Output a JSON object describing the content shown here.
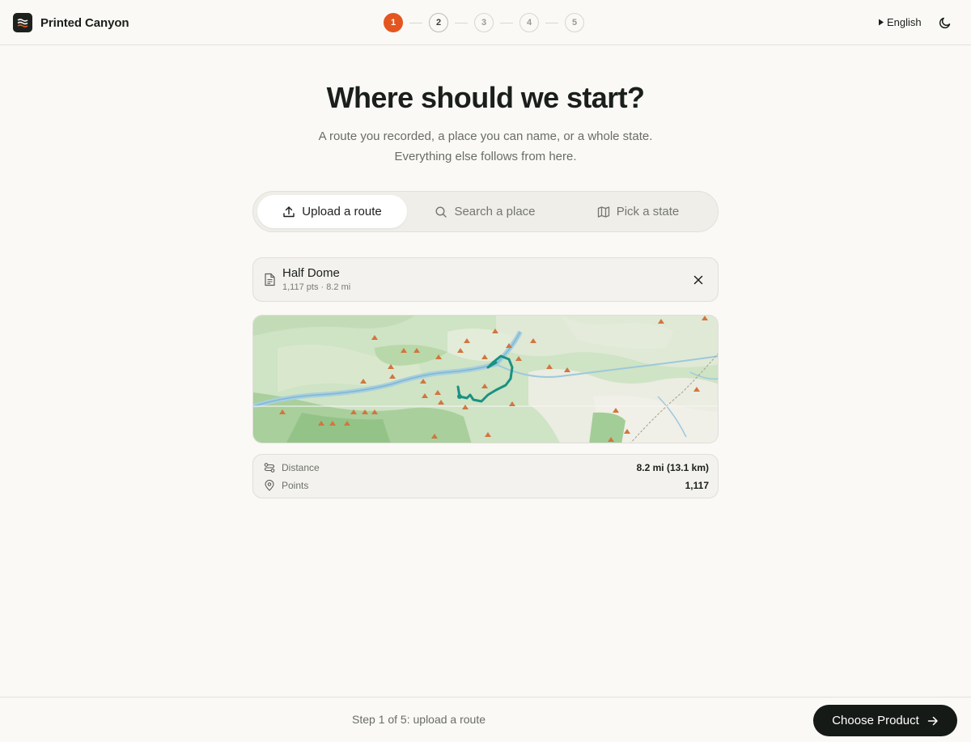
{
  "app": {
    "name": "Printed Canyon"
  },
  "stepper": {
    "steps": [
      "1",
      "2",
      "3",
      "4",
      "5"
    ],
    "current": 1
  },
  "header": {
    "language": "English"
  },
  "hero": {
    "title": "Where should we start?",
    "subtitle_line1": "A route you recorded, a place you can name, or a whole state.",
    "subtitle_line2": "Everything else follows from here."
  },
  "tabs": [
    {
      "label": "Upload a route",
      "icon": "upload-icon",
      "active": true
    },
    {
      "label": "Search a place",
      "icon": "search-icon",
      "active": false
    },
    {
      "label": "Pick a state",
      "icon": "map-icon",
      "active": false
    }
  ],
  "file": {
    "name": "Half Dome",
    "meta": "1,117 pts · 8.2 mi"
  },
  "stats": [
    {
      "label": "Distance",
      "value": "8.2 mi (13.1 km)",
      "icon": "route-icon"
    },
    {
      "label": "Points",
      "value": "1,117",
      "icon": "pin-icon"
    }
  ],
  "footer": {
    "status": "Step 1 of 5: upload a route",
    "next_label": "Choose Product"
  },
  "colors": {
    "accent": "#e4561f",
    "route": "#1a9183",
    "primary_button": "#161a17"
  }
}
